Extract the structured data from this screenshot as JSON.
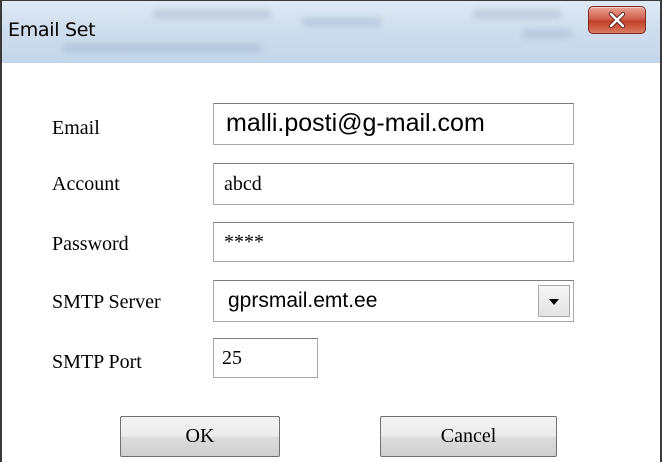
{
  "window": {
    "title": "Email Set",
    "close_icon": "close-x-icon"
  },
  "form": {
    "email_label": "Email",
    "email_value": "malli.posti@g-mail.com",
    "account_label": "Account",
    "account_value": "abcd",
    "password_label": "Password",
    "password_value": "****",
    "smtp_server_label": "SMTP Server",
    "smtp_server_value": "gprsmail.emt.ee",
    "smtp_port_label": "SMTP Port",
    "smtp_port_value": "25"
  },
  "buttons": {
    "ok_label": "OK",
    "cancel_label": "Cancel"
  },
  "colors": {
    "close_button": "#c9452f",
    "title_bar": "#cfdeed"
  }
}
